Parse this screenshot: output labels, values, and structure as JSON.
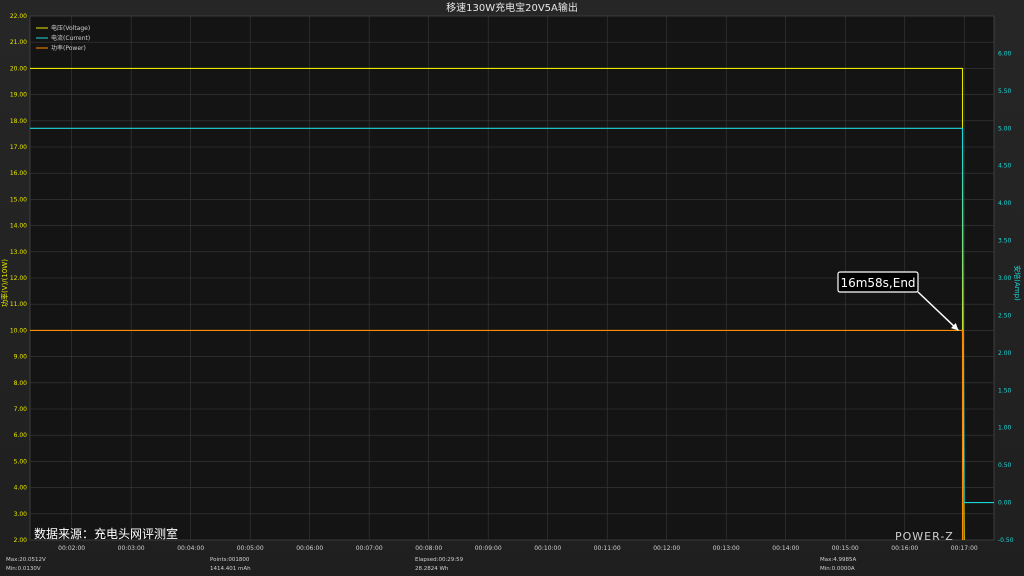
{
  "chart_data": {
    "type": "line",
    "title": "移速130W充电宝20V5A输出",
    "y_left": {
      "label": "功率(V)/(10W)",
      "ylim": [
        2,
        22
      ],
      "ticks": [
        "2.00",
        "3.00",
        "4.00",
        "5.00",
        "6.00",
        "7.00",
        "8.00",
        "9.00",
        "10.00",
        "11.00",
        "12.00",
        "13.00",
        "14.00",
        "15.00",
        "16.00",
        "17.00",
        "18.00",
        "19.00",
        "20.00",
        "21.00",
        "22.00"
      ]
    },
    "y_right": {
      "label": "安培(Amp)",
      "ylim": [
        -0.5,
        6.5
      ],
      "ticks": [
        "-0.50",
        "0.00",
        "0.50",
        "1.00",
        "1.50",
        "2.00",
        "2.50",
        "3.00",
        "3.50",
        "4.00",
        "4.50",
        "5.00",
        "5.50",
        "6.00"
      ]
    },
    "x": {
      "ticks": [
        "00:02:00",
        "00:03:00",
        "00:04:00",
        "00:05:00",
        "00:06:00",
        "00:07:00",
        "00:08:00",
        "00:09:00",
        "00:10:00",
        "00:11:00",
        "00:12:00",
        "00:13:00",
        "00:14:00",
        "00:15:00",
        "00:16:00",
        "00:17:00"
      ],
      "tick_minutes": [
        2,
        3,
        4,
        5,
        6,
        7,
        8,
        9,
        10,
        11,
        12,
        13,
        14,
        15,
        16,
        17
      ],
      "range_minutes": [
        1.3,
        17.5
      ]
    },
    "legend": [
      "电压(Voltage)",
      "电流(Current)",
      "功率(Power)"
    ],
    "legend_placement": "top-left",
    "grid": true,
    "series": [
      {
        "name": "电压(Voltage)",
        "axis": "left",
        "color": "#e8e800",
        "points": [
          [
            1.3,
            20.0
          ],
          [
            16.97,
            20.0
          ],
          [
            16.97,
            10.0
          ],
          [
            17.0,
            2.0
          ]
        ]
      },
      {
        "name": "电流(Current)",
        "axis": "right",
        "color": "#1fd6d6",
        "points": [
          [
            1.3,
            5.0
          ],
          [
            16.97,
            5.0
          ],
          [
            16.98,
            3.0
          ],
          [
            17.0,
            0.0
          ],
          [
            17.5,
            0.0
          ]
        ]
      },
      {
        "name": "功率(Power)",
        "axis": "left",
        "color": "#ff8c00",
        "points": [
          [
            1.3,
            10.0
          ],
          [
            16.97,
            10.0
          ],
          [
            16.97,
            2.0
          ]
        ]
      }
    ],
    "annotation": {
      "text": "16m58s,End",
      "x_minutes": 16.97,
      "y_left": 10.0
    },
    "watermark": "数据来源：充电头网评测室",
    "brand": "POWER-Z",
    "stats": {
      "voltage_max": "Max:20.0512V",
      "voltage_min": "Min:0.0130V",
      "points": "Points:001800",
      "capacity": "1414.401 mAh",
      "elapsed": "Elapsed:00:29:59",
      "energy": "28.2824 Wh",
      "current_max": "Max:4.9985A",
      "current_min": "Min:0.0000A"
    }
  }
}
